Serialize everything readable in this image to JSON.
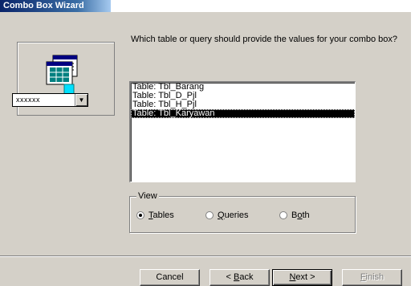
{
  "window": {
    "title": "Combo Box Wizard"
  },
  "illustration": {
    "combo_sample_text": "xxxxxx",
    "combo_arrow": "▼"
  },
  "question": "Which table or query should provide the values for your combo box?",
  "list": {
    "items": [
      "Table: Tbl_Barang",
      "Table: Tbl_D_Pjl",
      "Table: Tbl_H_Pjl",
      "Table: Tbl_Karyawan"
    ],
    "selected_index": 3
  },
  "view": {
    "legend": "View",
    "options": [
      {
        "label": "Tables",
        "accel": "T",
        "rest": "ables",
        "checked": true
      },
      {
        "label": "Queries",
        "accel": "Q",
        "rest": "ueries",
        "checked": false
      },
      {
        "label": "Both",
        "prefix": "B",
        "accel": "o",
        "rest": "th",
        "checked": false
      }
    ]
  },
  "buttons": {
    "cancel": "Cancel",
    "back": {
      "prefix": "< ",
      "accel": "B",
      "rest": "ack"
    },
    "next": {
      "accel": "N",
      "rest": "ext >"
    },
    "finish": {
      "accel": "F",
      "rest": "inish"
    }
  }
}
